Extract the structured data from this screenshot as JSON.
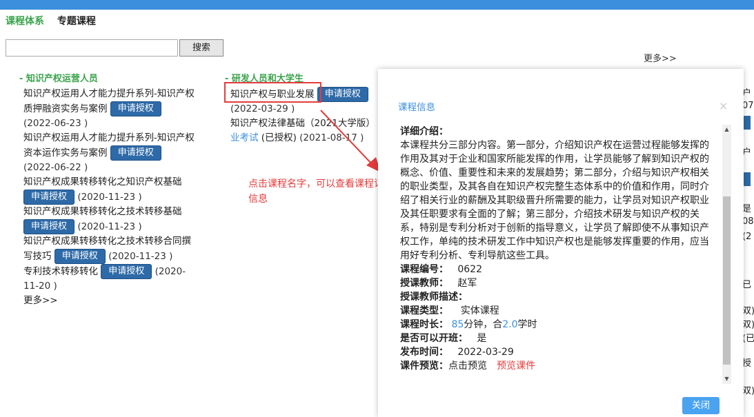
{
  "tabs": {
    "active": "课程体系",
    "other": "专题课程"
  },
  "search": {
    "button": "搜索",
    "placeholder": ""
  },
  "more_top": "更多>>",
  "col1": {
    "title": "- 知识产权运营人员",
    "items": [
      {
        "title": "知识产权运用人才能力提升系列-知识产权质押融资实务与案例",
        "date": "(2022-06-23 )"
      },
      {
        "title": "知识产权运用人才能力提升系列-知识产权资本运作实务与案例",
        "date": "(2022-06-22 )"
      },
      {
        "title": "知识产权成果转移转化之知识产权基础",
        "date": "(2020-11-23 )"
      },
      {
        "title": "知识产权成果转移转化之技术转移基础",
        "date": "(2020-11-23 )"
      },
      {
        "title": "知识产权成果转移转化之技术转移合同撰写技巧",
        "date": "(2020-11-23 )"
      },
      {
        "title": "专利技术转移转化",
        "date": "(2020-11-20 )"
      }
    ],
    "more": "更多>>"
  },
  "col2": {
    "title": "- 研发人员和大学生",
    "items": [
      {
        "title": "知识产权与职业发展",
        "date": "(2022-03-29 )"
      },
      {
        "title": "知识产权法律基础（2021大学版）",
        "title_suffix": "业考试",
        "status": "(已授权)",
        "date": "(2021-08-17 )"
      }
    ]
  },
  "request_btn": "申请授权",
  "annotation": "点击课程名字，可以查看课程详细信息",
  "modal": {
    "title": "课程信息",
    "close_x": "×",
    "detail_label": "详细介绍：",
    "detail_text": "本课程共分三部分内容。第一部分，介绍知识产权在运营过程能够发挥的作用及其对于企业和国家所能发挥的作用，让学员能够了解到知识产权的概念、价值、重要性和未来的发展趋势；第二部分，介绍与知识产权相关的职业类型，及其各自在知识产权完整生态体系中的价值和作用，同时介绍了相关行业的薪酬及其职级晋升所需要的能力，让学员对知识产权职业及其任职要求有全面的了解；第三部分，介绍技术研发与知识产权的关系，特别是专利分析对于创新的指导意义，让学员了解即使不从事知识产权工作，单纯的技术研发工作中知识产权也是能够发挥重要的作用，应当用好专利分析、专利导航这些工具。",
    "code_label": "课程编号：",
    "code": "0622",
    "teacher_label": "授课教师：",
    "teacher": "赵军",
    "teacher_desc_label": "授课教师描述：",
    "type_label": "课程类型：",
    "type": "实体课程",
    "duration_label": "课程时长：",
    "minutes": "85",
    "minutes_unit": "分钟，合",
    "hours": "2.0",
    "hours_unit": "学时",
    "open_label": "是否可以开班：",
    "open": "是",
    "publish_label": "发布时间：",
    "publish": "2022-03-29",
    "preview_label": "课件预览：",
    "preview": "点击预览",
    "preview_annotation": "预览课件",
    "close_button": "关闭"
  },
  "right_peek": [
    "户",
    "07",
    "户",
    "是",
    "08",
    "(2",
    "已",
    "双)",
    "双)",
    "(已",
    "授",
    "双)"
  ]
}
